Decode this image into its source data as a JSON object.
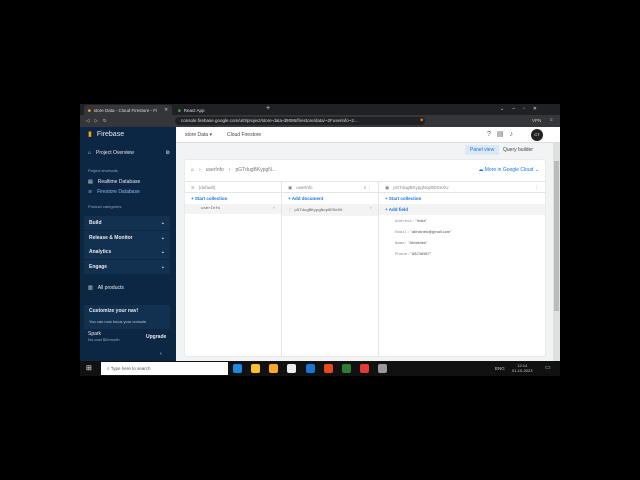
{
  "browser": {
    "tabs": [
      "store Data - Cloud Firestore - Fi",
      "React App"
    ],
    "url": "console.firebase.google.com/u/0/project/store-data-d9086/firestore/data/~2Fuserinfo~2...",
    "vpn": "VPN"
  },
  "sidebar": {
    "brand": "Firebase",
    "overview": "Project Overview",
    "shortcuts_label": "Project shortcuts",
    "shortcuts": [
      "Realtime Database",
      "Firestore Database"
    ],
    "categories_label": "Product categories",
    "categories": [
      "Build",
      "Release & Monitor",
      "Analytics",
      "Engage"
    ],
    "all_products": "All products",
    "customize_title": "Customize your nav!",
    "customize_text": "You can now focus your console",
    "plan": "Spark",
    "plan_sub": "No-cost $0/month",
    "upgrade": "Upgrade"
  },
  "header": {
    "project": "store Data",
    "section": "Cloud Firestore",
    "avatar": "CT"
  },
  "views": {
    "panel": "Panel view",
    "query": "Query builder"
  },
  "breadcrumb": {
    "items": [
      "userInfo",
      "pGTdugBKypgN..."
    ],
    "more": "More in Google Cloud"
  },
  "columns": {
    "root": {
      "title": "(default)",
      "action": "Start collection",
      "items": [
        "userInfo"
      ]
    },
    "collection": {
      "title": "userInfo",
      "action": "Add document",
      "items": [
        "pGTdugBKypgNop9DSeXU"
      ]
    },
    "document": {
      "title": "pGTdugBKypgNop9DSeXU",
      "action1": "Start collection",
      "action2": "Add field",
      "fields": [
        {
          "k": "Address:",
          "v": "\"India\""
        },
        {
          "k": "Email:",
          "v": "\"abhishek@gmail.com\""
        },
        {
          "k": "Name:",
          "v": "\"Abhishek\""
        },
        {
          "k": "Phone:",
          "v": "\"65236987\""
        }
      ]
    }
  },
  "taskbar": {
    "search": "Type here to search",
    "lang": "ENG",
    "time": "12:14",
    "date": "01-10-2023"
  }
}
